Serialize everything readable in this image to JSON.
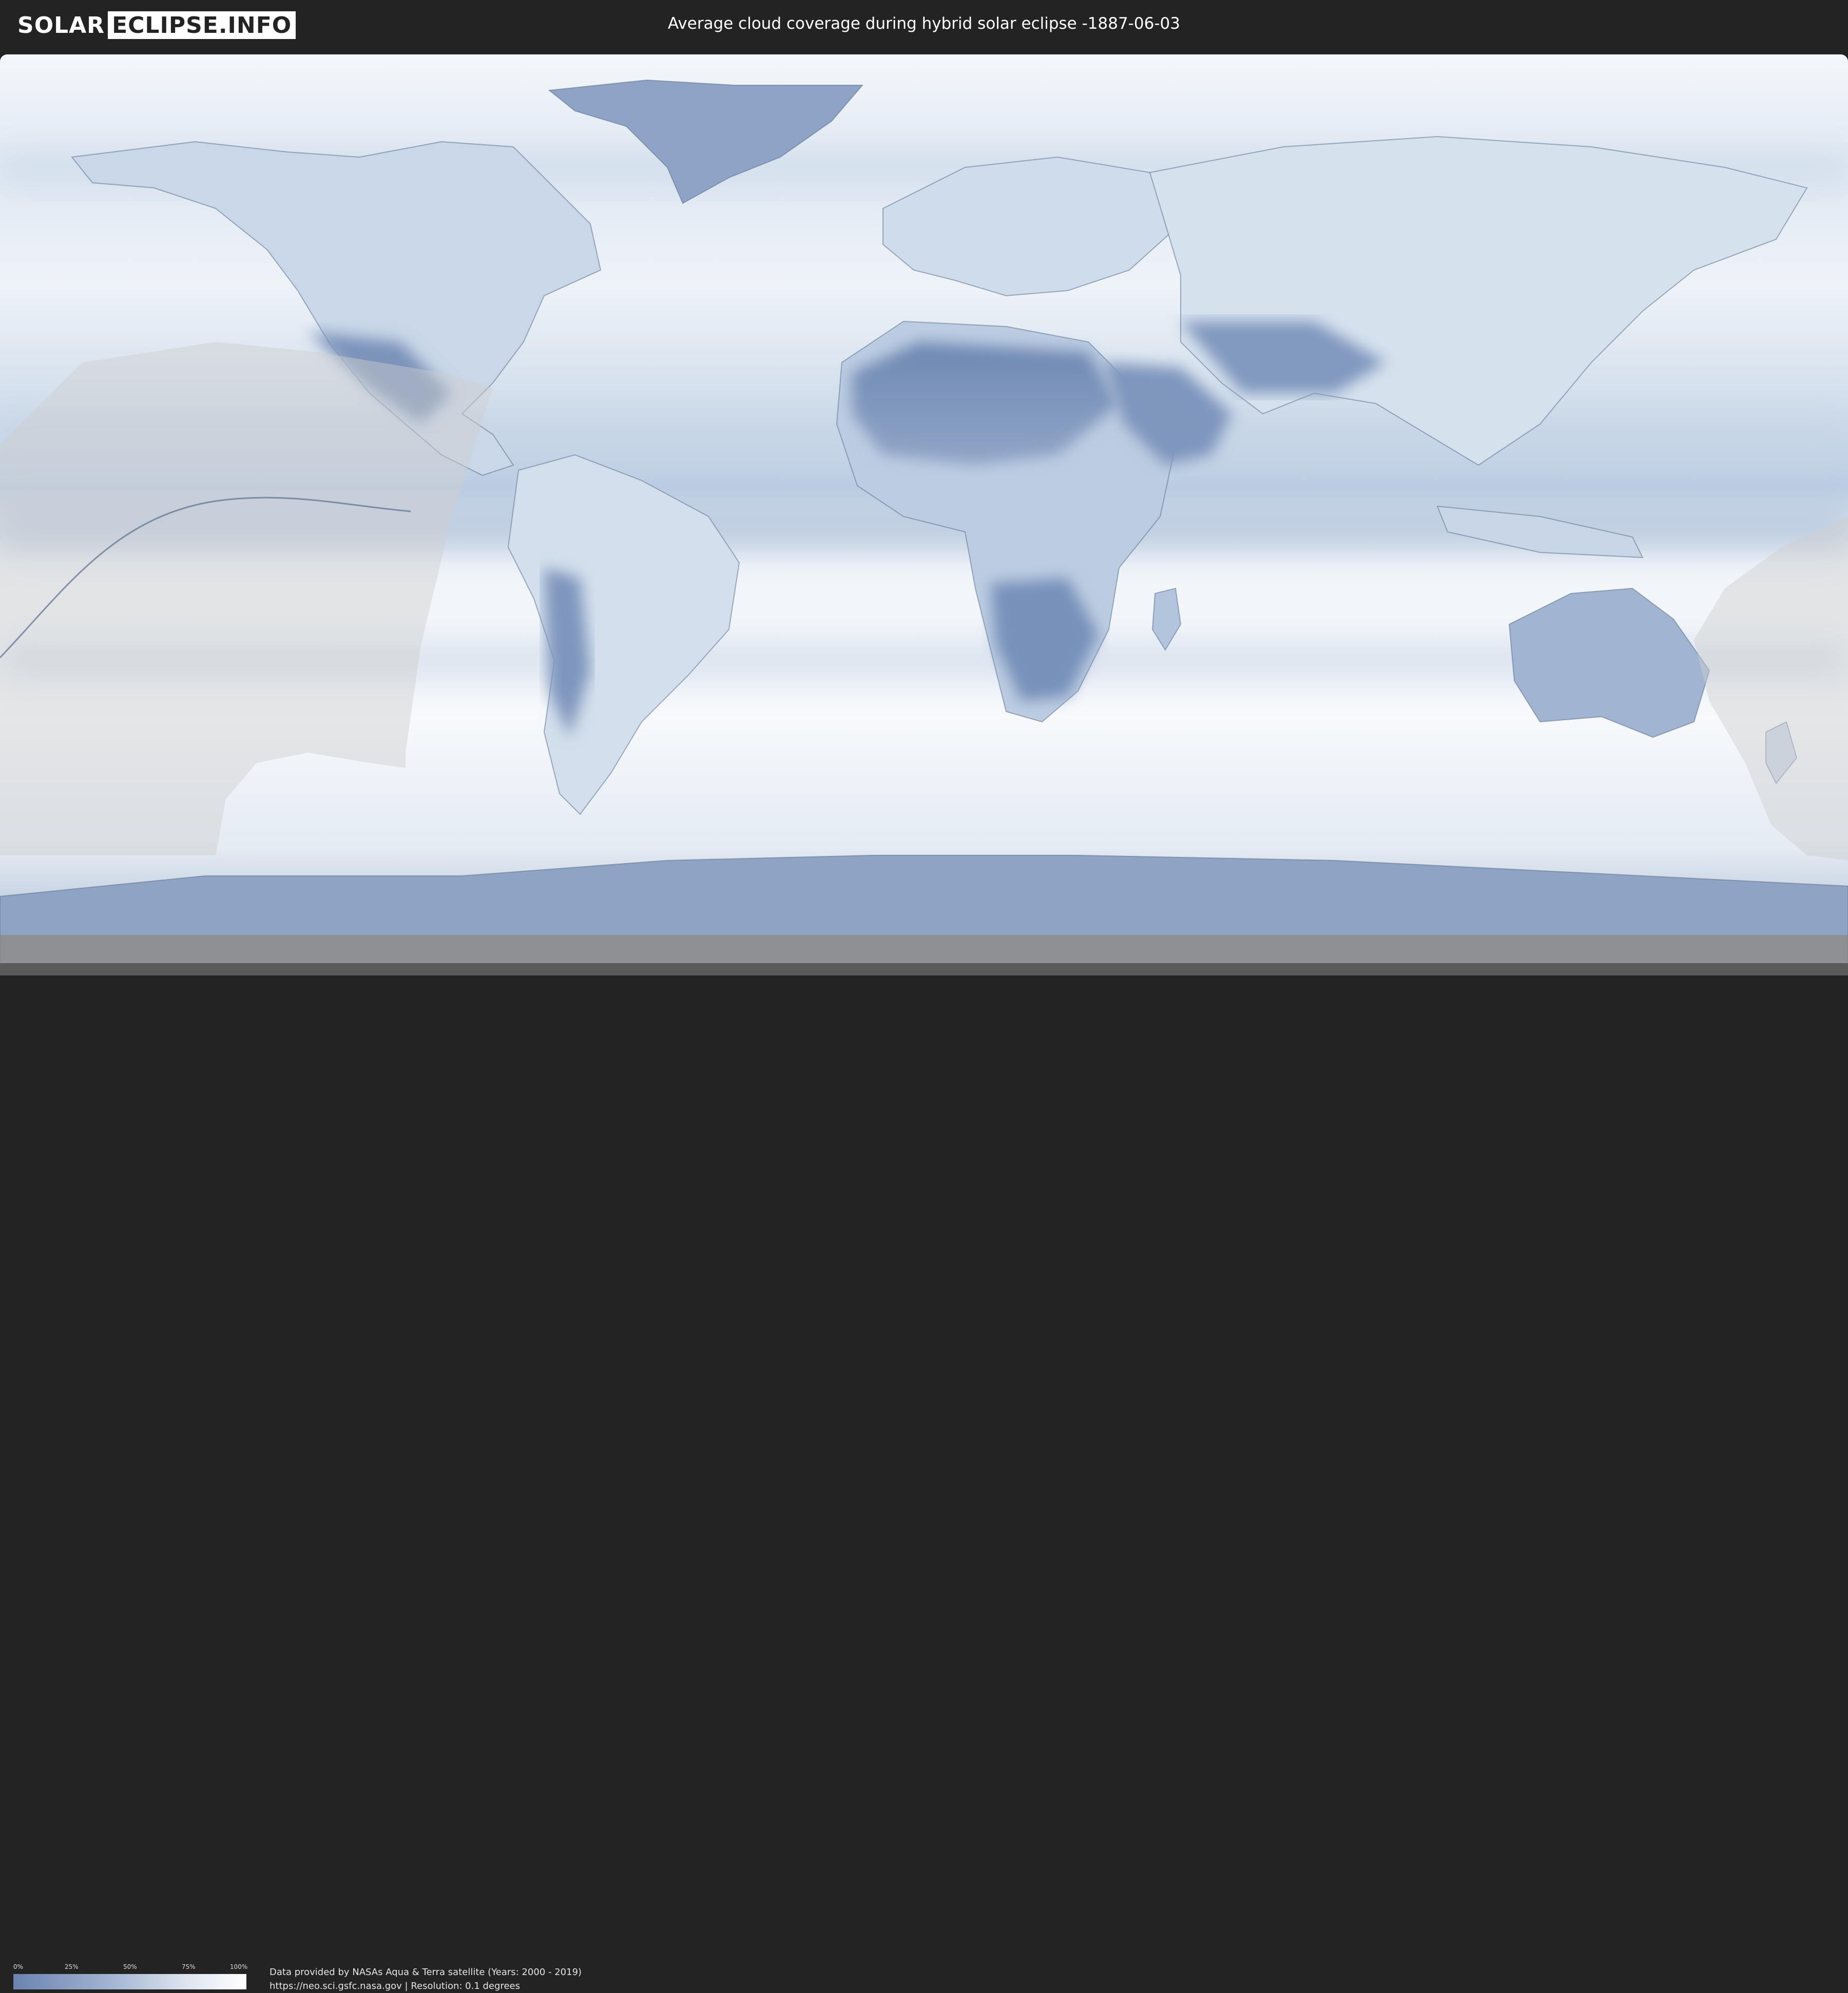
{
  "header": {
    "logo_left": "SOLAR",
    "logo_right": "ECLIPSE.INFO",
    "title": "Average cloud coverage during hybrid solar eclipse -1887-06-03"
  },
  "legend": {
    "ticks": [
      "0%",
      "25%",
      "50%",
      "75%",
      "100%"
    ],
    "color_low": "#6b83b0",
    "color_high": "#ffffff"
  },
  "credits": {
    "line1": "Data provided by NASAs Aqua & Terra satellite (Years: 2000 - 2019)",
    "line2": "https://neo.sci.gsfc.nasa.gov | Resolution: 0.1 degrees"
  },
  "colors": {
    "background": "#232323",
    "ocean_cloud": "#eef3f8",
    "land_clear": "#7d95bd",
    "shadow_overlay": "#d8d8d8"
  }
}
